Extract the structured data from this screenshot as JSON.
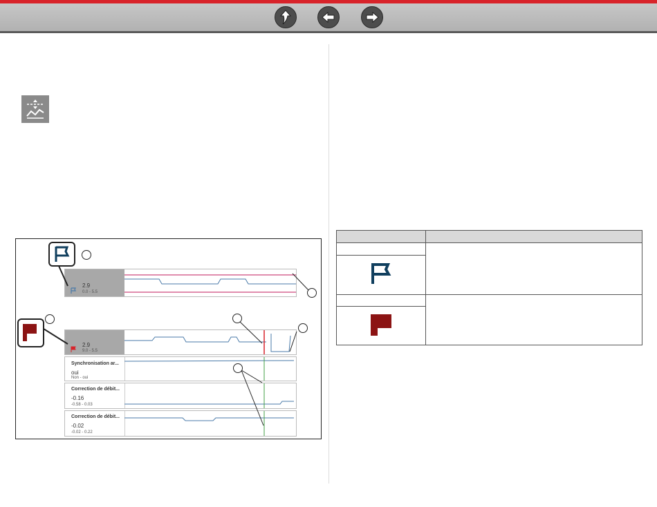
{
  "nav": {
    "buttons": [
      "up-arrow-icon",
      "back-arrow-icon",
      "forward-arrow-icon"
    ]
  },
  "colors": {
    "accent": "#d8232a",
    "flag_blue": "#103f5e",
    "flag_red": "#8c1414",
    "trace": "#4a7aa8"
  },
  "figure": {
    "top_panel": {
      "value": "2.9",
      "range": "0.0 - 5.5"
    },
    "main_panel": {
      "value": "2.9",
      "range": "9.0 - 5.5"
    },
    "rows": [
      {
        "label": "Synchronisation ar...",
        "value": "oui",
        "range": "Non - oui"
      },
      {
        "label": "Correction de débit...",
        "value": "-0.16",
        "range": "-0.58 - 0.03"
      },
      {
        "label": "Correction de débit...",
        "value": "-0.02",
        "range": "-0.02 - 0.22"
      }
    ]
  }
}
